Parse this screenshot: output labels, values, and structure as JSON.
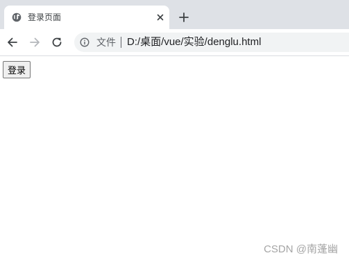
{
  "tab": {
    "title": "登录页面",
    "favicon": "globe-icon",
    "close": "close-icon"
  },
  "toolbar": {
    "back": "back-arrow-icon",
    "forward": "forward-arrow-icon",
    "reload": "reload-icon",
    "new_tab": "plus-icon"
  },
  "omnibox": {
    "info_icon": "info-icon",
    "security_label": "文件",
    "url": "D:/桌面/vue/实验/denglu.html"
  },
  "page": {
    "login_button_label": "登录"
  },
  "watermark": {
    "text": "CSDN @南蓬幽"
  },
  "colors": {
    "tabstrip_bg": "#dee1e6",
    "omnibox_bg": "#f1f3f4",
    "text_primary": "#202124",
    "text_secondary": "#5f6368"
  }
}
